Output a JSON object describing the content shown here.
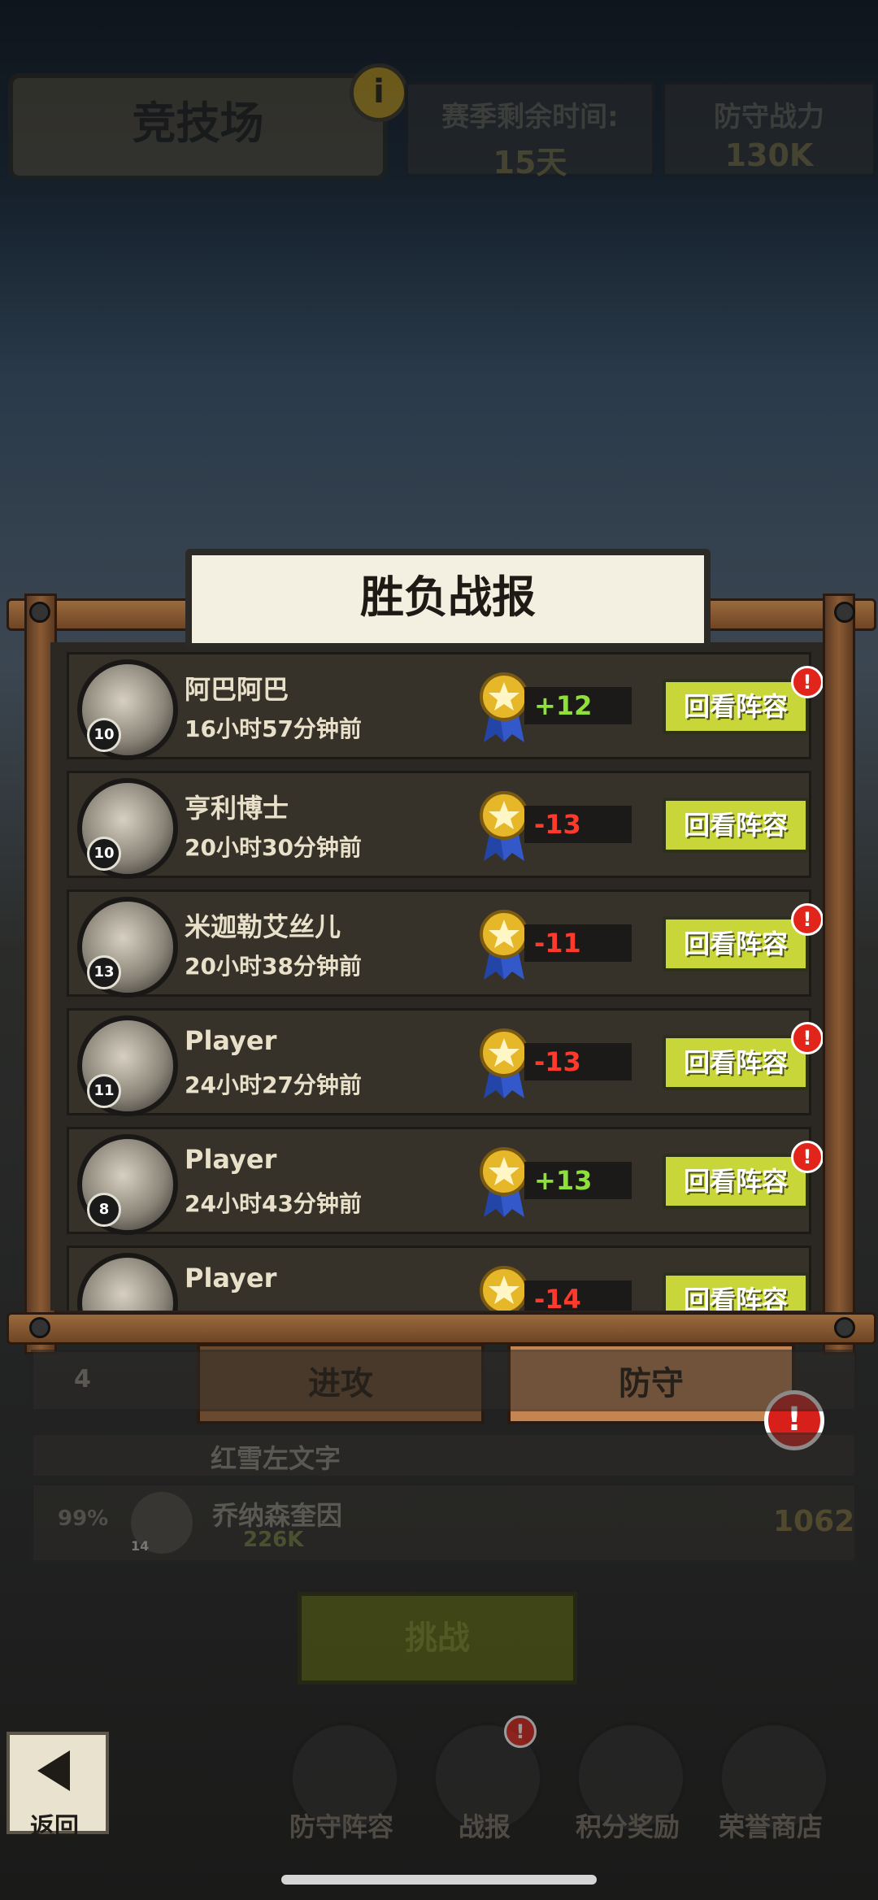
{
  "header": {
    "title": "竞技场",
    "season_label": "赛季剩余时间:",
    "season_value": "15天",
    "defense_label": "防守战力",
    "defense_value": "130K"
  },
  "dialog": {
    "title": "胜负战报",
    "review_label": "回看阵容",
    "entries": [
      {
        "name": "阿巴阿巴",
        "time": "16小时57分钟前",
        "level": "10",
        "score": "+12",
        "result": "pos",
        "alert": true
      },
      {
        "name": "亨利博士",
        "time": "20小时30分钟前",
        "level": "10",
        "score": "-13",
        "result": "neg",
        "alert": false
      },
      {
        "name": "米迦勒艾丝儿",
        "time": "20小时38分钟前",
        "level": "13",
        "score": "-11",
        "result": "neg",
        "alert": true
      },
      {
        "name": "Player",
        "time": "24小时27分钟前",
        "level": "11",
        "score": "-13",
        "result": "neg",
        "alert": true
      },
      {
        "name": "Player",
        "time": "24小时43分钟前",
        "level": "8",
        "score": "+13",
        "result": "pos",
        "alert": true
      },
      {
        "name": "Player",
        "time": "",
        "level": "",
        "score": "-14",
        "result": "neg",
        "alert": false
      }
    ]
  },
  "tabs": {
    "attack": "进攻",
    "defend": "防守"
  },
  "background_rows": [
    {
      "rank": "4",
      "name": "红雪左文字"
    },
    {
      "rank": "99%",
      "name": "乔纳森奎因",
      "power": "226K",
      "score": "1062",
      "level": "14"
    }
  ],
  "challenge_button": "挑战",
  "bottom_nav": {
    "back": "返回",
    "items": [
      "防守阵容",
      "战报",
      "积分奖励",
      "荣誉商店"
    ]
  },
  "colors": {
    "positive": "#8fe13a",
    "negative": "#ff3a2c",
    "review_button": "#c9d63a",
    "alert": "#e1251b"
  }
}
